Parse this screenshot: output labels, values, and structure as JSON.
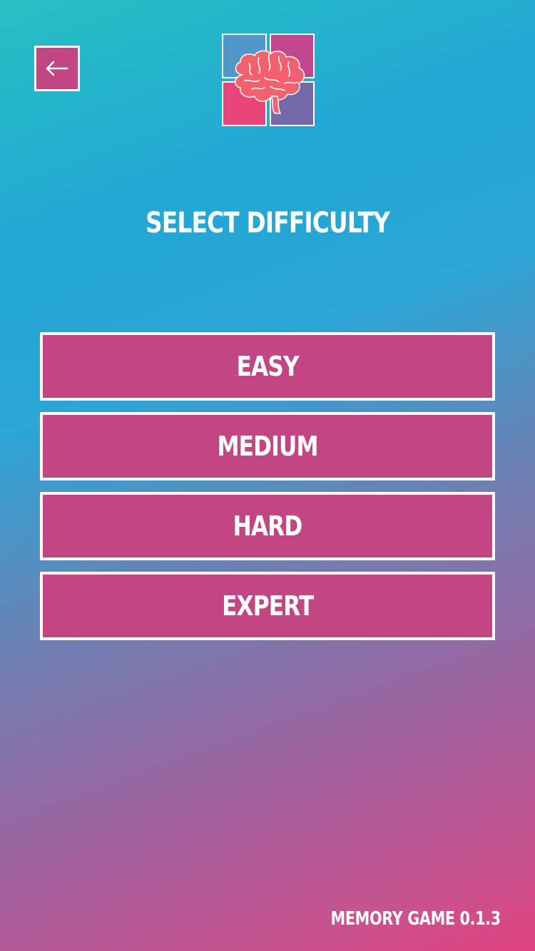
{
  "header": {
    "back_icon": "arrow-left-icon",
    "logo_icon": "brain-icon",
    "logo_tile_colors": [
      "#4f98c9",
      "#c0478d",
      "#e8467a",
      "#7568a9"
    ]
  },
  "main": {
    "title": "SELECT DIFFICULTY",
    "difficulties": [
      {
        "label": "EASY"
      },
      {
        "label": "MEDIUM"
      },
      {
        "label": "HARD"
      },
      {
        "label": "EXPERT"
      }
    ]
  },
  "footer": {
    "version": "MEMORY GAME 0.1.3"
  },
  "colors": {
    "button_bg": "#c24584",
    "button_border": "#ffffff",
    "text": "#ffffff",
    "gradient_start": "#27c0c2",
    "gradient_end": "#e0427f"
  }
}
